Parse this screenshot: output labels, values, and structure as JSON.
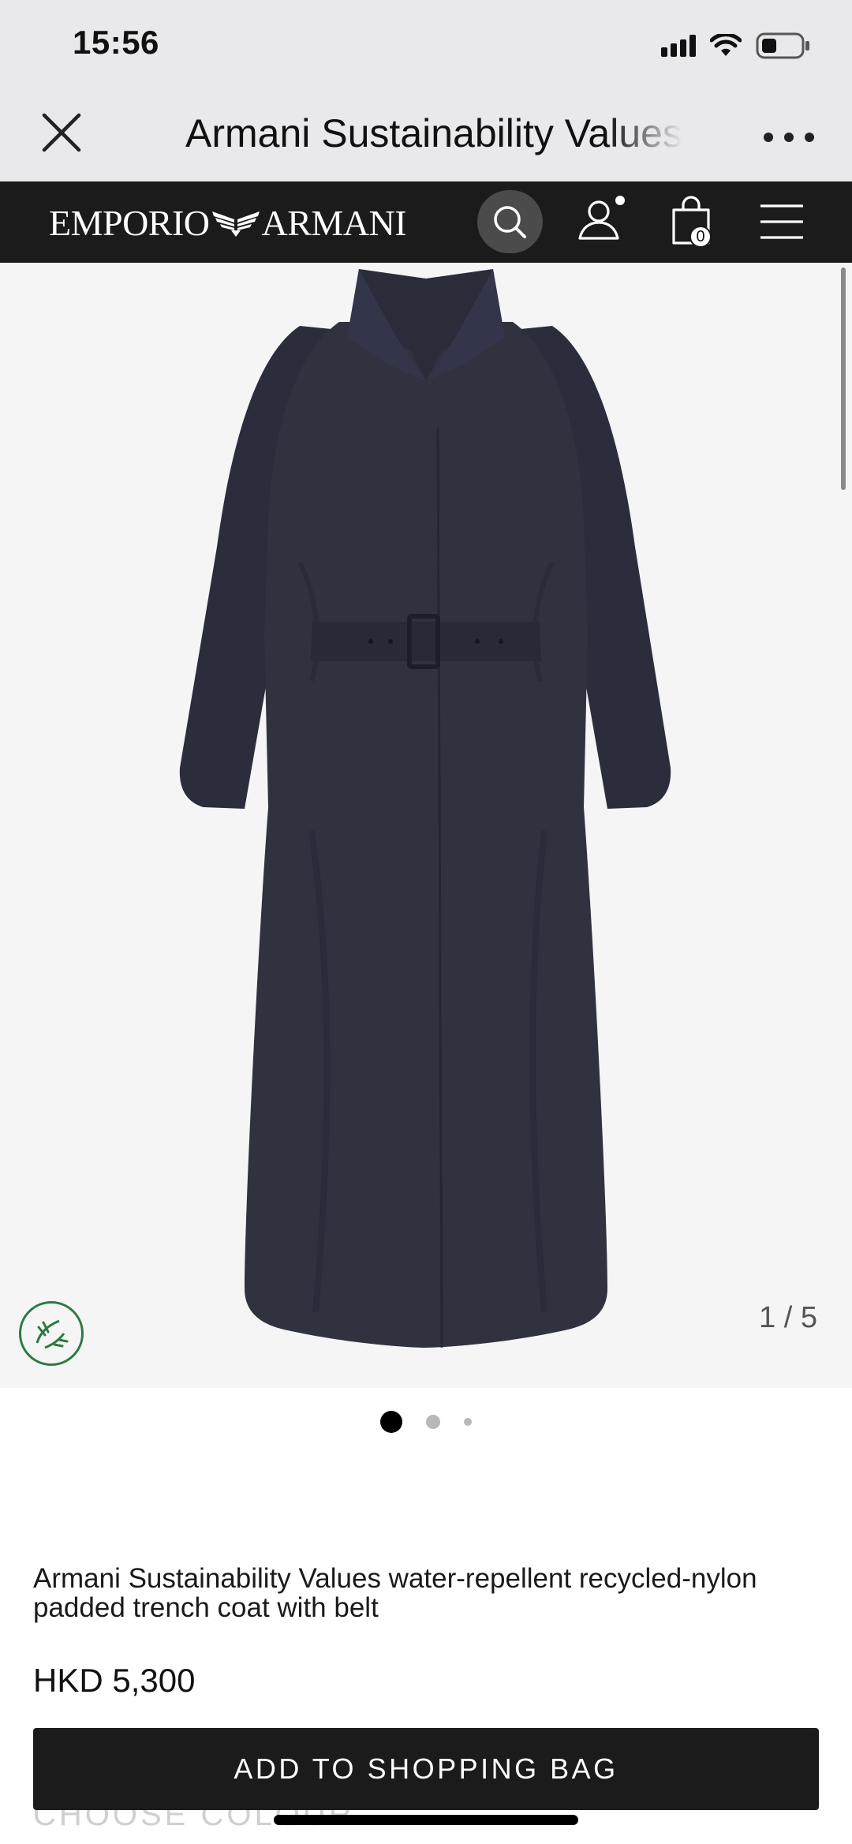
{
  "status_bar": {
    "time": "15:56"
  },
  "browser": {
    "title": "Armani Sustainability Values water-repellent recycled-nylon padded trench coat with belt"
  },
  "site_nav": {
    "brand": {
      "left_word": "EMPORIO",
      "right_word": "ARMANI"
    },
    "bag_count": "0"
  },
  "gallery": {
    "counter": "1 / 5"
  },
  "product": {
    "name": "Armani Sustainability Values water-repellent recycled-nylon padded trench coat with belt",
    "price": "HKD 5,300"
  },
  "actions": {
    "add_to_bag_label": "ADD TO SHOPPING BAG"
  },
  "partial_section": {
    "label": "CHOOSE COLOUR"
  },
  "colors": {
    "nav_bg": "#1b1b1b",
    "coat": "#2f3142",
    "badge_green": "#2c7a43"
  }
}
